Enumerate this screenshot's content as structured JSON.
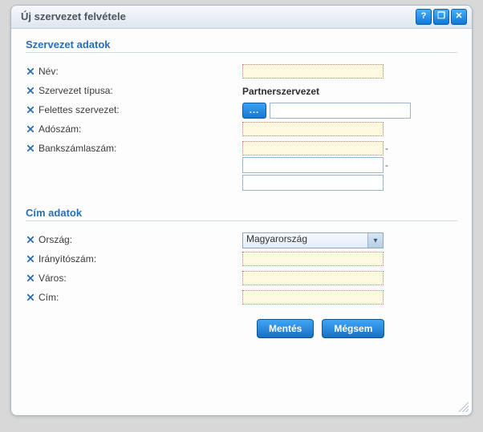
{
  "window": {
    "title": "Új szervezet felvétele",
    "help_glyph": "?",
    "max_glyph": "❐",
    "close_glyph": "✕"
  },
  "section1": {
    "title": "Szervezet adatok"
  },
  "fields": {
    "nev": {
      "label": "Név:",
      "value": ""
    },
    "tipus": {
      "label": "Szervezet típusa:",
      "value": "Partnerszervezet"
    },
    "felettes": {
      "label": "Felettes szervezet:",
      "lookup_label": "...",
      "value": ""
    },
    "adoszam": {
      "label": "Adószám:",
      "value": ""
    },
    "bankszamla": {
      "label": "Bankszámlaszám:",
      "part1": "",
      "part2": "",
      "part3": ""
    }
  },
  "section2": {
    "title": "Cím adatok"
  },
  "addr": {
    "orszag": {
      "label": "Ország:",
      "value": "Magyarország"
    },
    "irsz": {
      "label": "Irányítószám:",
      "value": ""
    },
    "varos": {
      "label": "Város:",
      "value": ""
    },
    "cim": {
      "label": "Cím:",
      "value": ""
    }
  },
  "buttons": {
    "save": "Mentés",
    "cancel": "Mégsem"
  }
}
